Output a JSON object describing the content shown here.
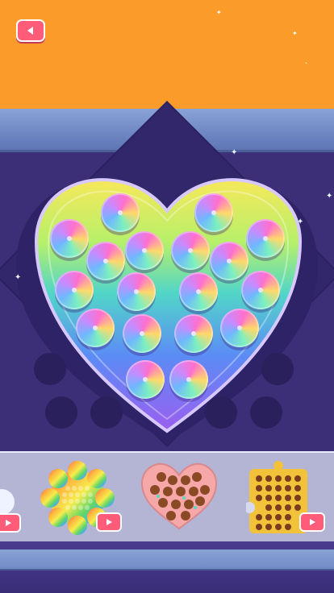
{
  "screen": {
    "name": "pop-it-heart-level"
  },
  "header": {
    "back_icon": "arrow-left-icon",
    "accent_color": "#fb9b2a",
    "button_color": "#ff5c7a"
  },
  "board": {
    "shape": "heart",
    "theme": "rainbow-gradient",
    "pop_count": 20
  },
  "tray": {
    "items": [
      {
        "name": "rainbow-flower-pop-it",
        "locked_ad": true
      },
      {
        "name": "chocolate-heart-pop-it",
        "locked_ad": false
      },
      {
        "name": "cookie-puzzle-pop-it",
        "locked_ad": true
      }
    ]
  },
  "colors": {
    "board_bg": "#3c2e77",
    "rail": "#7b94cc",
    "tray_bg": "#d6daf0"
  }
}
